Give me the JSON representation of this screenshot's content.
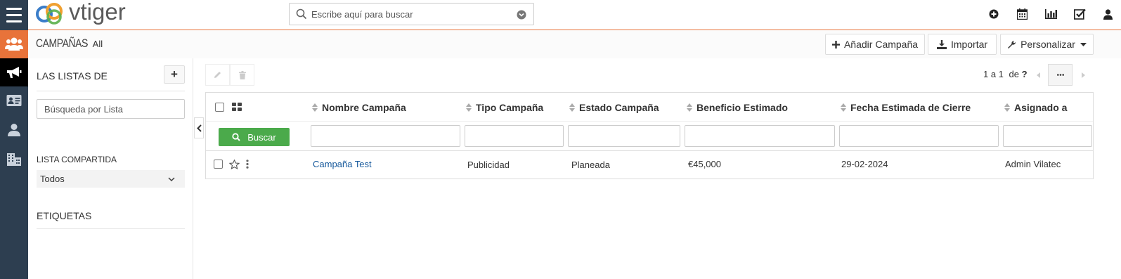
{
  "app": {
    "logo_text": "vtiger"
  },
  "search": {
    "placeholder": "Escribe aquí para buscar"
  },
  "breadcrumb": {
    "module": "CAMPAÑAS",
    "view": "All"
  },
  "header_buttons": {
    "add": "Añadir Campaña",
    "import": "Importar",
    "customize": "Personalizar"
  },
  "left_panel": {
    "lists_title": "LAS LISTAS DE",
    "add_label": "+",
    "list_search_placeholder": "Búsqueda por Lista",
    "shared_title": "LISTA COMPARTIDA",
    "shared_selected": "Todos",
    "tags_title": "ETIQUETAS"
  },
  "pager": {
    "range": "1 a 1",
    "of": "de",
    "total": "?"
  },
  "table": {
    "columns": [
      "Nombre Campaña",
      "Tipo Campaña",
      "Estado Campaña",
      "Beneficio Estimado",
      "Fecha Estimada de Cierre",
      "Asignado a"
    ],
    "search_button": "Buscar",
    "rows": [
      {
        "name": "Campaña Test",
        "type": "Publicidad",
        "status": "Planeada",
        "revenue": "€45,000",
        "close_date": "29-02-2024",
        "assigned": "Admin Vilatec"
      }
    ]
  },
  "colors": {
    "accent": "#e8733a",
    "rail": "#2d3e50",
    "search_button": "#4baa4b",
    "link": "#15589b"
  },
  "icons": [
    "menu-icon",
    "users-icon",
    "megaphone-icon",
    "contact-card-icon",
    "person-icon",
    "building-icon",
    "search-icon",
    "chevron-down-icon",
    "plus-circle-icon",
    "calendar-icon",
    "bar-chart-icon",
    "checkbox-icon",
    "user-icon"
  ]
}
